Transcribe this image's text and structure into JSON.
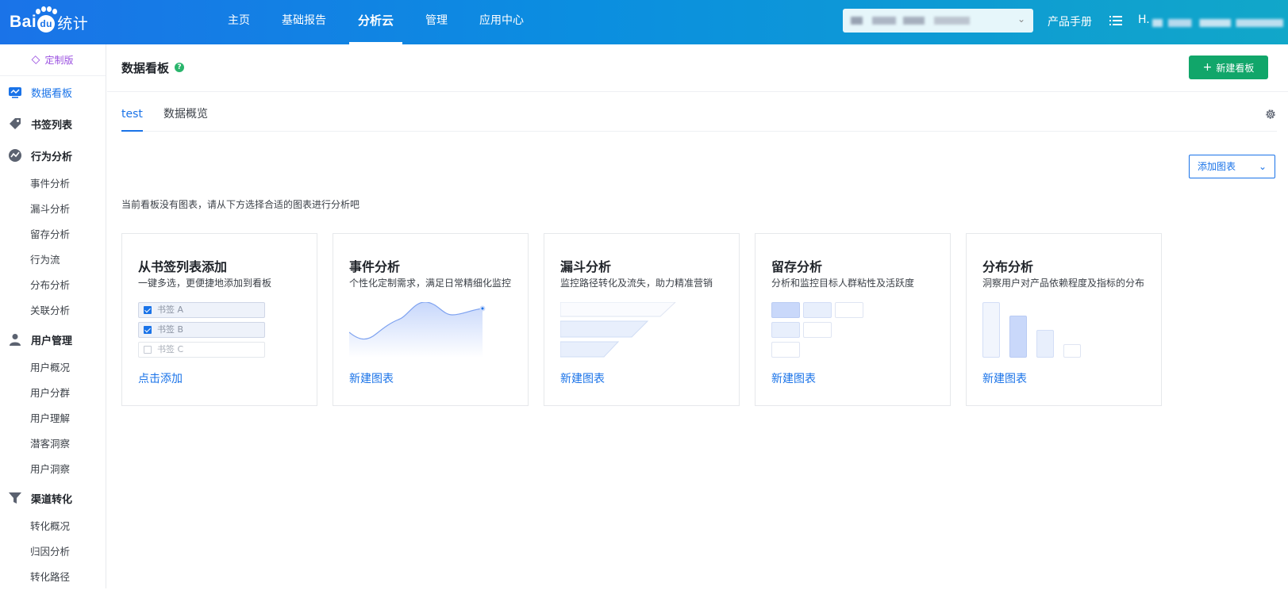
{
  "topbar": {
    "logo_text": "Bai",
    "logo_du": "du",
    "logo_cn": "统计",
    "nav": [
      "主页",
      "基础报告",
      "分析云",
      "管理",
      "应用中心"
    ],
    "active_nav": "分析云",
    "manual_label": "产品手册",
    "user_initial": "H."
  },
  "sidebar": {
    "edition": "定制版",
    "groups": [
      {
        "label": "数据看板",
        "icon": "dashboard-icon",
        "active": true,
        "items": []
      },
      {
        "label": "书签列表",
        "icon": "tag-icon",
        "items": []
      },
      {
        "label": "行为分析",
        "icon": "trend-icon",
        "items": [
          "事件分析",
          "漏斗分析",
          "留存分析",
          "行为流",
          "分布分析",
          "关联分析"
        ]
      },
      {
        "label": "用户管理",
        "icon": "user-icon",
        "items": [
          "用户概况",
          "用户分群",
          "用户理解",
          "潜客洞察",
          "用户洞察"
        ]
      },
      {
        "label": "渠道转化",
        "icon": "funnel-icon",
        "items": [
          "转化概况",
          "归因分析",
          "转化路径"
        ]
      }
    ]
  },
  "main": {
    "title": "数据看板",
    "help": "?",
    "new_board_label": "新建看板",
    "tabs": [
      "test",
      "数据概览"
    ],
    "active_tab": "test",
    "add_chart_label": "添加图表",
    "empty_tip": "当前看板没有图表，请从下方选择合适的图表进行分析吧",
    "cards": [
      {
        "title": "从书签列表添加",
        "desc": "一键多选，更便捷地添加到看板",
        "link": "点击添加",
        "bookmarks": [
          "书签 A",
          "书签 B",
          "书签 C"
        ]
      },
      {
        "title": "事件分析",
        "desc": "个性化定制需求，满足日常精细化监控",
        "link": "新建图表"
      },
      {
        "title": "漏斗分析",
        "desc": "监控路径转化及流失，助力精准营销",
        "link": "新建图表"
      },
      {
        "title": "留存分析",
        "desc": "分析和监控目标人群粘性及活跃度",
        "link": "新建图表"
      },
      {
        "title": "分布分析",
        "desc": "洞察用户对产品依赖程度及指标的分布",
        "link": "新建图表"
      }
    ]
  },
  "colors": {
    "primary": "#1a73e8",
    "green": "#11a66a",
    "purple": "#9b51e0"
  }
}
